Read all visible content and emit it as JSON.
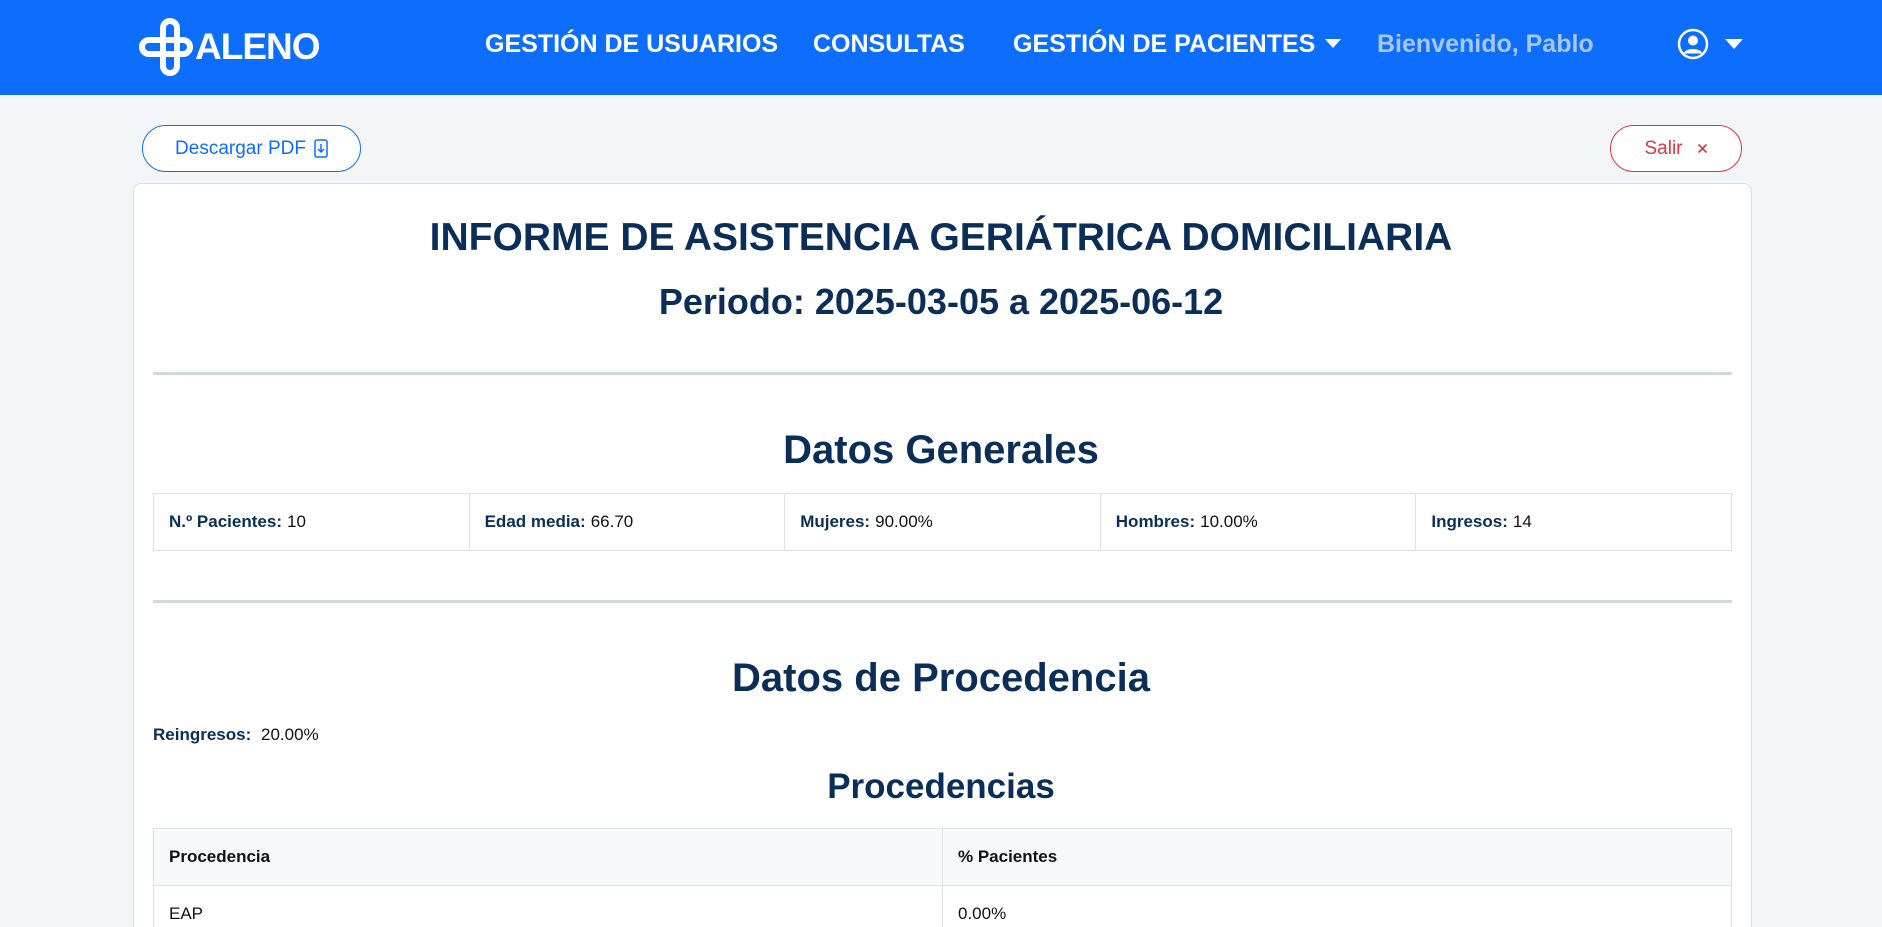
{
  "navbar": {
    "logo_text": "ALENO",
    "links": [
      {
        "label": "GESTIÓN DE USUARIOS"
      },
      {
        "label": "CONSULTAS"
      },
      {
        "label": "GESTIÓN DE PACIENTES"
      }
    ],
    "welcome": "Bienvenido, Pablo",
    "colors": {
      "bar": "#0d6efd",
      "welcome": "#a8c6f5"
    }
  },
  "actions": {
    "download_label": "Descargar PDF",
    "download_icon": "download-file-icon",
    "exit_label": "Salir",
    "exit_icon": "close-icon"
  },
  "report": {
    "title": "INFORME DE ASISTENCIA GERIÁTRICA DOMICILIARIA",
    "period": "Periodo: 2025-03-05 a 2025-06-12",
    "general": {
      "heading": "Datos Generales",
      "stats": [
        {
          "label": "N.º Pacientes:",
          "value": "10"
        },
        {
          "label": "Edad media:",
          "value": "66.70"
        },
        {
          "label": "Mujeres:",
          "value": "90.00%"
        },
        {
          "label": "Hombres:",
          "value": "10.00%"
        },
        {
          "label": "Ingresos:",
          "value": "14"
        }
      ]
    },
    "origin": {
      "heading": "Datos de Procedencia",
      "reingresos_label": "Reingresos:",
      "reingresos_value": "20.00%",
      "sub_heading": "Procedencias",
      "table": {
        "headers": [
          "Procedencia",
          "% Pacientes"
        ],
        "rows": [
          [
            "EAP",
            "0.00%"
          ]
        ]
      }
    },
    "colors": {
      "heading": "#0b2e59",
      "divider": "#cfd8e3"
    }
  }
}
